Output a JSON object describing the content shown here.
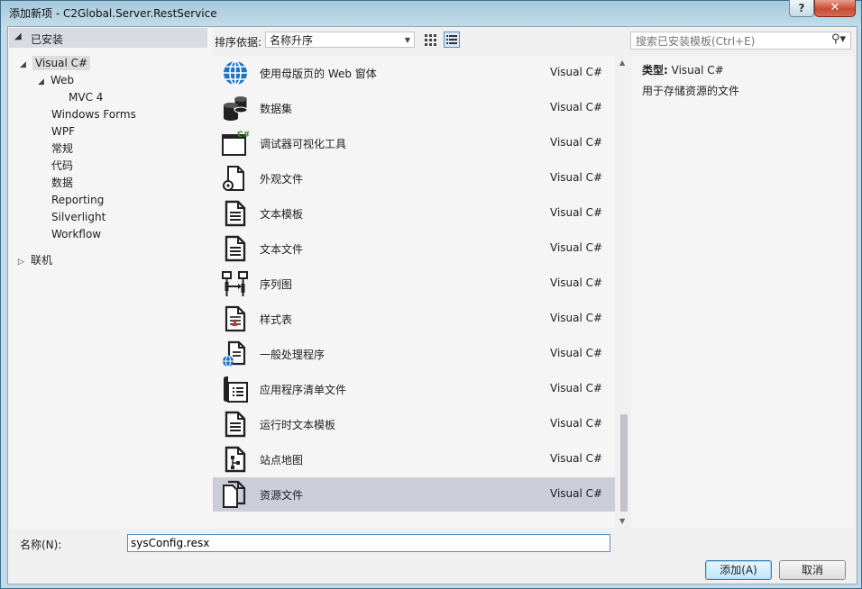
{
  "window": {
    "title": "添加新项 - C2Global.Server.RestService",
    "close_glyph": "✕",
    "help_glyph": "?"
  },
  "tree": {
    "installed_label": "已安装",
    "items": [
      {
        "label": "Visual C#",
        "expander": "◢",
        "selected": true
      },
      {
        "label": "Web",
        "expander": "◢"
      },
      {
        "label": "MVC 4",
        "expander": ""
      },
      {
        "label": "Windows Forms",
        "expander": ""
      },
      {
        "label": "WPF",
        "expander": ""
      },
      {
        "label": "常规",
        "expander": ""
      },
      {
        "label": "代码",
        "expander": ""
      },
      {
        "label": "数据",
        "expander": ""
      },
      {
        "label": "Reporting",
        "expander": ""
      },
      {
        "label": "Silverlight",
        "expander": ""
      },
      {
        "label": "Workflow",
        "expander": ""
      },
      {
        "label": "联机",
        "expander": "▷"
      }
    ]
  },
  "sort": {
    "label": "排序依据:",
    "value": "名称升序"
  },
  "search": {
    "placeholder": "搜索已安装模板(Ctrl+E)"
  },
  "templates": [
    {
      "name": "使用母版页的 Web 窗体",
      "lang": "Visual C#",
      "icon": "globe-icon"
    },
    {
      "name": "数据集",
      "lang": "Visual C#",
      "icon": "dataset-icon"
    },
    {
      "name": "调试器可视化工具",
      "lang": "Visual C#",
      "icon": "debugger-visualizer-icon"
    },
    {
      "name": "外观文件",
      "lang": "Visual C#",
      "icon": "skin-file-icon"
    },
    {
      "name": "文本模板",
      "lang": "Visual C#",
      "icon": "text-template-icon"
    },
    {
      "name": "文本文件",
      "lang": "Visual C#",
      "icon": "text-file-icon"
    },
    {
      "name": "序列图",
      "lang": "Visual C#",
      "icon": "sequence-diagram-icon"
    },
    {
      "name": "样式表",
      "lang": "Visual C#",
      "icon": "stylesheet-icon"
    },
    {
      "name": "一般处理程序",
      "lang": "Visual C#",
      "icon": "generic-handler-icon"
    },
    {
      "name": "应用程序清单文件",
      "lang": "Visual C#",
      "icon": "manifest-icon"
    },
    {
      "name": "运行时文本模板",
      "lang": "Visual C#",
      "icon": "runtime-text-template-icon"
    },
    {
      "name": "站点地图",
      "lang": "Visual C#",
      "icon": "sitemap-icon"
    },
    {
      "name": "资源文件",
      "lang": "Visual C#",
      "icon": "resource-file-icon",
      "selected": true
    }
  ],
  "details": {
    "type_label": "类型:",
    "type_value": "Visual C#",
    "description": "用于存储资源的文件"
  },
  "name_field": {
    "label": "名称(N):",
    "value": "sysConfig.resx"
  },
  "buttons": {
    "add": "添加(A)",
    "cancel": "取消"
  },
  "colors": {
    "selected_row": "#cbcdd9",
    "installed_header": "#d8dbe3",
    "add_button_border": "#3c7fb1"
  }
}
